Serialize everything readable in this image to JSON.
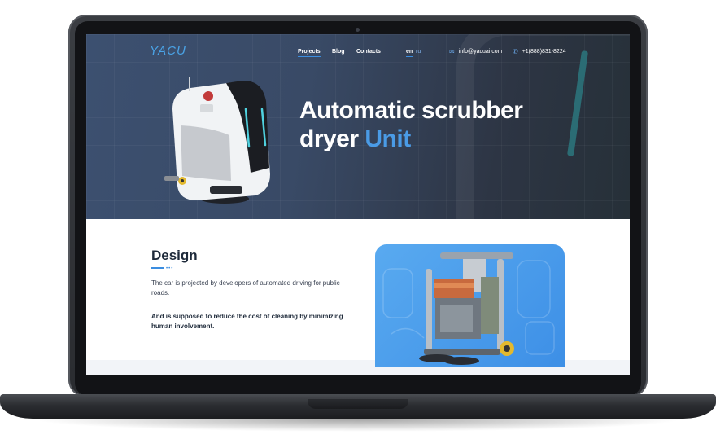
{
  "brand": {
    "logo_text": "YACU"
  },
  "nav": {
    "items": [
      {
        "label": "Projects",
        "active": true
      },
      {
        "label": "Blog",
        "active": false
      },
      {
        "label": "Contacts",
        "active": false
      }
    ]
  },
  "language": {
    "current": "en",
    "other": "ru"
  },
  "contacts": {
    "email": "info@yacuai.com",
    "phone": "+1(888)831-8224",
    "email_icon": "envelope-icon",
    "phone_icon": "phone-icon"
  },
  "hero": {
    "title_line1": "Automatic scrubber",
    "title_line2_plain": "dryer",
    "title_line2_accent": "Unit"
  },
  "design": {
    "heading": "Design",
    "paragraph1": "The car is projected by developers of automated driving for public roads.",
    "paragraph2": "And is supposed to reduce the cost of cleaning by minimizing human involvement."
  },
  "colors": {
    "accent": "#3b8de0",
    "hero_bg": "#394a66",
    "panel_bg": "#4a9be6",
    "dark_text": "#1e2a3a"
  }
}
